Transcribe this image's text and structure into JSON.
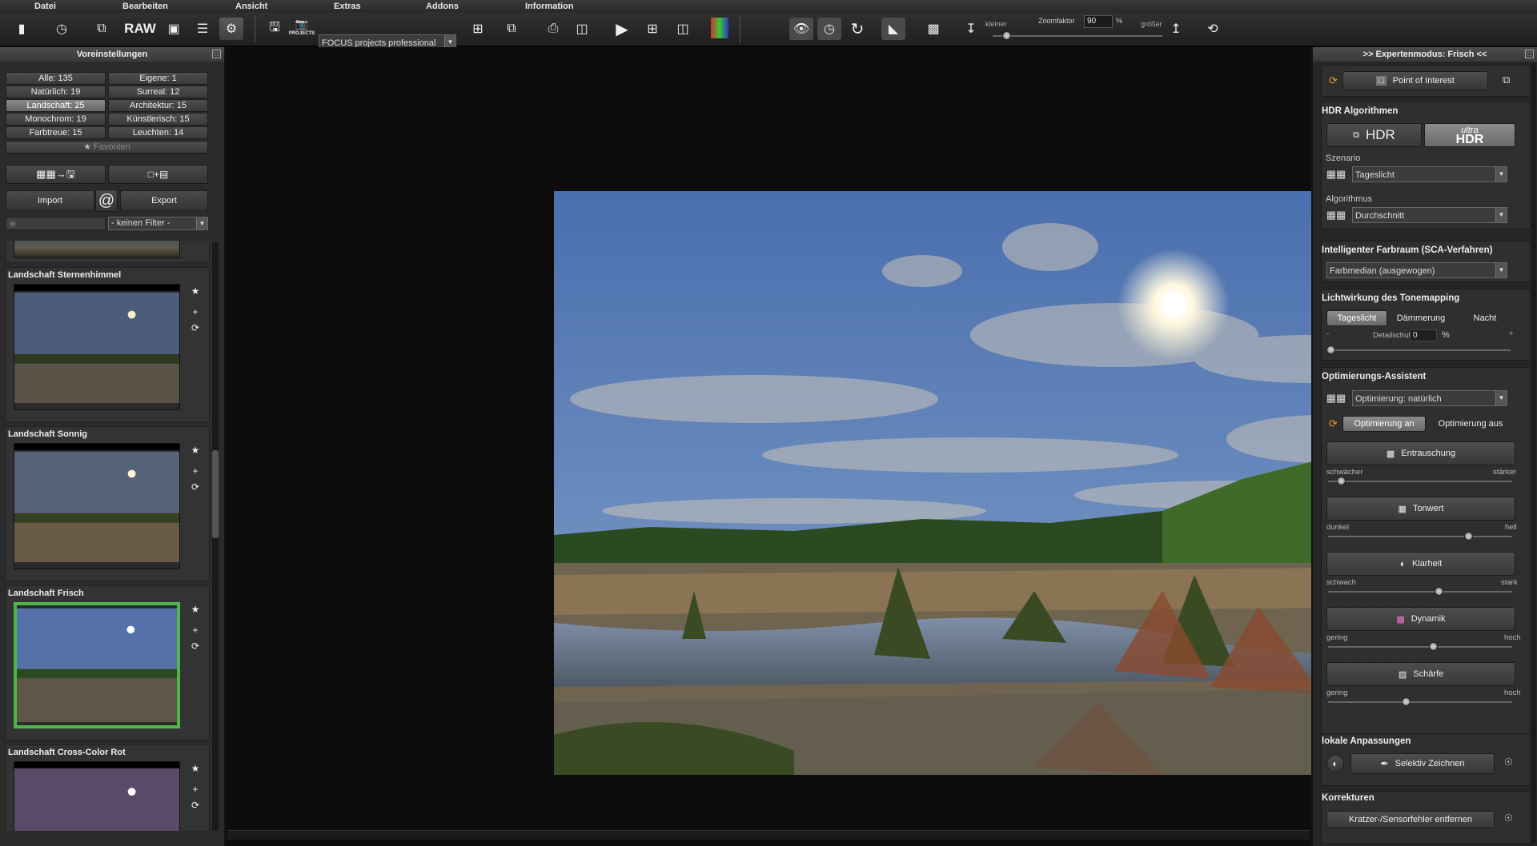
{
  "menu": [
    "Datei",
    "Bearbeiten",
    "Ansicht",
    "Extras",
    "Addons",
    "Information"
  ],
  "toolbar": {
    "raw_label": "RAW",
    "projects_label": "PROJECTS",
    "edition_combo": "FOCUS projects professional",
    "zoom_smaller": "kleiner",
    "zoom_label": "Zoomfaktor",
    "zoom_value": "90",
    "zoom_unit": "%",
    "zoom_larger": "größer"
  },
  "left": {
    "title": "Voreinstellungen",
    "categories": [
      {
        "label": "Alle: 135"
      },
      {
        "label": "Eigene: 1"
      },
      {
        "label": "Natürlich: 19"
      },
      {
        "label": "Surreal: 12"
      },
      {
        "label": "Landschaft: 25"
      },
      {
        "label": "Architektur: 15"
      },
      {
        "label": "Monochrom: 19"
      },
      {
        "label": "Künstlerisch: 15"
      },
      {
        "label": "Farbtreue: 15"
      },
      {
        "label": "Leuchten: 14"
      }
    ],
    "favorites": "Favoriten",
    "import": "Import",
    "export": "Export",
    "at_symbol": "@",
    "filter": "- keinen Filter -",
    "presets": [
      {
        "title": "Landschaft Sternenhimmel"
      },
      {
        "title": "Landschaft Sonnig"
      },
      {
        "title": "Landschaft Frisch"
      },
      {
        "title": "Landschaft Cross-Color Rot"
      }
    ]
  },
  "right": {
    "title": ">> Expertenmodus: Frisch <<",
    "poi": "Point of Interest",
    "hdr_title": "HDR Algorithmen",
    "hdr_btn": "HDR",
    "ultra_top": "ultra",
    "ultra_bottom": "HDR",
    "szenario_label": "Szenario",
    "szenario_value": "Tageslicht",
    "algo_label": "Algorithmus",
    "algo_value": "Durchschnitt",
    "farbraum_title": "Intelligenter Farbraum (SCA-Verfahren)",
    "farbraum_value": "Farbmedian (ausgewogen)",
    "licht_title": "Lichtwirkung des Tonemapping",
    "licht_tabs": [
      "Tageslicht",
      "Dämmerung",
      "Nacht"
    ],
    "detail_minus": "-",
    "detail_label": "Detailschutz",
    "detail_value": "0",
    "detail_unit": "%",
    "detail_plus": "+",
    "opt_title": "Optimierungs-Assistent",
    "opt_value": "Optimierung: natürlich",
    "opt_on": "Optimierung an",
    "opt_off": "Optimierung aus",
    "adjust": [
      {
        "label": "Entrauschung",
        "min": "schwächer",
        "max": "stärker",
        "level": 0.07
      },
      {
        "label": "Tonwert",
        "min": "dunkel",
        "max": "hell",
        "level": 0.76
      },
      {
        "label": "Klarheit",
        "min": "schwach",
        "max": "stark",
        "level": 0.6
      },
      {
        "label": "Dynamik",
        "min": "gering",
        "max": "hoch",
        "level": 0.57
      },
      {
        "label": "Schärfe",
        "min": "gering",
        "max": "hoch",
        "level": 0.42
      }
    ],
    "local_title": "lokale Anpassungen",
    "selektiv": "Selektiv Zeichnen",
    "korr_title": "Korrekturen",
    "korr_btn": "Kratzer-/Sensorfehler entfernen"
  }
}
